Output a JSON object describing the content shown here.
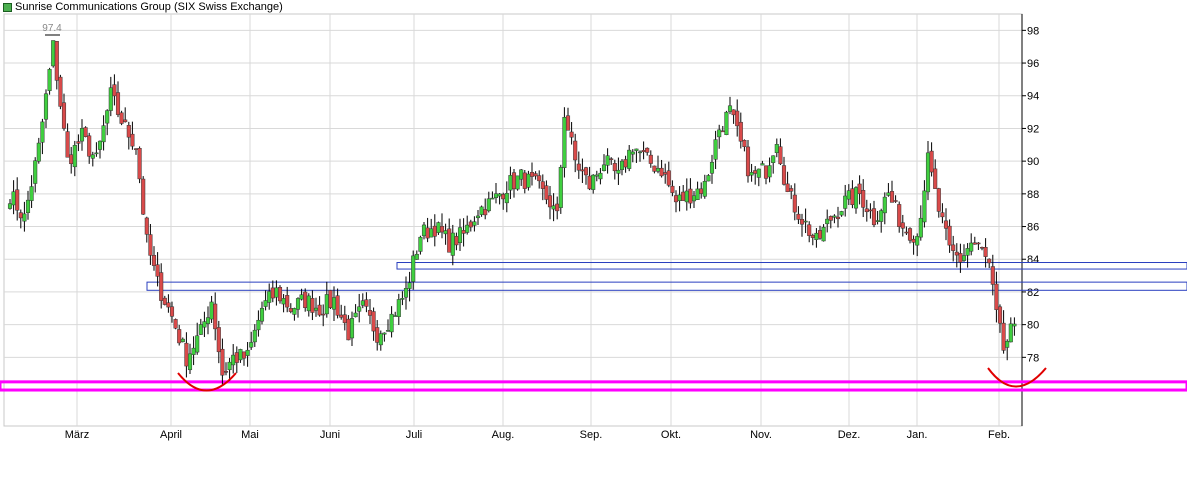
{
  "chart_data": {
    "type": "candlestick",
    "title": "Sunrise Communications Group (SIX Swiss Exchange)",
    "legend_color": "#4caf50",
    "colors": {
      "up": "#3fcf3f",
      "down": "#d94a4a",
      "wick": "#000000",
      "support_band": "#ff00ff",
      "arc": "#e00000",
      "resistance": "#2a3fbf",
      "grid": "#d9d9d9"
    },
    "ylim": [
      73.8,
      99
    ],
    "y_ticks": [
      78,
      80,
      82,
      84,
      86,
      88,
      90,
      92,
      94,
      96,
      98
    ],
    "x_labels": [
      "März",
      "April",
      "Mai",
      "Juni",
      "Juli",
      "Aug.",
      "Sep.",
      "Okt.",
      "Nov.",
      "Dez.",
      "Jan.",
      "Feb."
    ],
    "grid": true,
    "annotations": {
      "high_label": "97.4"
    },
    "resistance_zones": [
      [
        82.1,
        82.6
      ],
      [
        83.4,
        83.8
      ]
    ],
    "support_band": [
      76.0,
      76.5
    ],
    "anchors": [
      {
        "i": 0,
        "v": 88.0
      },
      {
        "i": 4,
        "v": 86.5
      },
      {
        "i": 8,
        "v": 90.8
      },
      {
        "i": 12,
        "v": 97.0
      },
      {
        "i": 16,
        "v": 90.0
      },
      {
        "i": 20,
        "v": 91.5
      },
      {
        "i": 24,
        "v": 90.0
      },
      {
        "i": 28,
        "v": 94.0
      },
      {
        "i": 32,
        "v": 92.0
      },
      {
        "i": 35,
        "v": 91.0
      },
      {
        "i": 38,
        "v": 85.0
      },
      {
        "i": 41,
        "v": 82.5
      },
      {
        "i": 45,
        "v": 80.5
      },
      {
        "i": 49,
        "v": 78.0
      },
      {
        "i": 53,
        "v": 79.5
      },
      {
        "i": 56,
        "v": 81.5
      },
      {
        "i": 59,
        "v": 77.0
      },
      {
        "i": 62,
        "v": 78.0
      },
      {
        "i": 66,
        "v": 78.0
      },
      {
        "i": 70,
        "v": 81.0
      },
      {
        "i": 74,
        "v": 82.0
      },
      {
        "i": 78,
        "v": 81.0
      },
      {
        "i": 82,
        "v": 81.5
      },
      {
        "i": 86,
        "v": 81.0
      },
      {
        "i": 90,
        "v": 81.5
      },
      {
        "i": 94,
        "v": 79.5
      },
      {
        "i": 98,
        "v": 81.0
      },
      {
        "i": 102,
        "v": 79.5
      },
      {
        "i": 106,
        "v": 80.5
      },
      {
        "i": 110,
        "v": 82.0
      },
      {
        "i": 114,
        "v": 85.5
      },
      {
        "i": 118,
        "v": 86.0
      },
      {
        "i": 122,
        "v": 85.0
      },
      {
        "i": 126,
        "v": 85.5
      },
      {
        "i": 130,
        "v": 87.0
      },
      {
        "i": 134,
        "v": 87.5
      },
      {
        "i": 138,
        "v": 88.5
      },
      {
        "i": 142,
        "v": 89.0
      },
      {
        "i": 146,
        "v": 88.5
      },
      {
        "i": 150,
        "v": 87.5
      },
      {
        "i": 152,
        "v": 86.5
      },
      {
        "i": 154,
        "v": 93.0
      },
      {
        "i": 157,
        "v": 90.0
      },
      {
        "i": 161,
        "v": 88.5
      },
      {
        "i": 165,
        "v": 90.0
      },
      {
        "i": 169,
        "v": 89.0
      },
      {
        "i": 173,
        "v": 91.0
      },
      {
        "i": 177,
        "v": 90.0
      },
      {
        "i": 181,
        "v": 89.5
      },
      {
        "i": 185,
        "v": 87.5
      },
      {
        "i": 189,
        "v": 88.0
      },
      {
        "i": 193,
        "v": 88.5
      },
      {
        "i": 197,
        "v": 92.0
      },
      {
        "i": 200,
        "v": 93.0
      },
      {
        "i": 203,
        "v": 91.0
      },
      {
        "i": 206,
        "v": 89.0
      },
      {
        "i": 210,
        "v": 89.5
      },
      {
        "i": 213,
        "v": 91.5
      },
      {
        "i": 216,
        "v": 88.0
      },
      {
        "i": 220,
        "v": 86.5
      },
      {
        "i": 224,
        "v": 85.0
      },
      {
        "i": 228,
        "v": 86.5
      },
      {
        "i": 232,
        "v": 87.5
      },
      {
        "i": 236,
        "v": 88.0
      },
      {
        "i": 240,
        "v": 86.5
      },
      {
        "i": 244,
        "v": 88.0
      },
      {
        "i": 248,
        "v": 86.0
      },
      {
        "i": 252,
        "v": 85.5
      },
      {
        "i": 255,
        "v": 90.0
      },
      {
        "i": 258,
        "v": 87.0
      },
      {
        "i": 261,
        "v": 84.5
      },
      {
        "i": 264,
        "v": 84.0
      },
      {
        "i": 267,
        "v": 85.0
      },
      {
        "i": 270,
        "v": 84.5
      },
      {
        "i": 272,
        "v": 83.5
      },
      {
        "i": 274,
        "v": 80.5
      },
      {
        "i": 276,
        "v": 78.5
      },
      {
        "i": 278,
        "v": 79.5
      }
    ]
  }
}
